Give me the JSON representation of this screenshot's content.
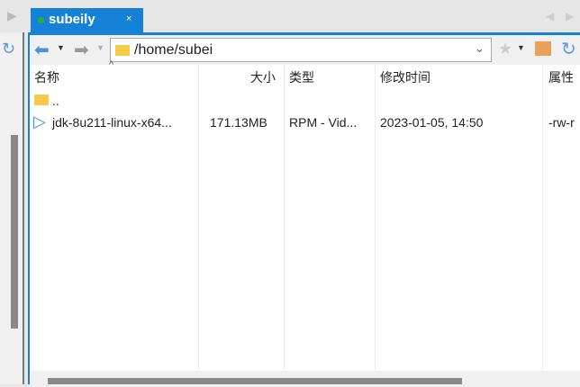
{
  "tab": {
    "title": "subeily",
    "close": "×",
    "status_color": "#27b23a"
  },
  "address": {
    "path": "/home/subei"
  },
  "columns": {
    "name": "名称",
    "size": "大小",
    "type": "类型",
    "modified": "修改时间",
    "attrs": "属性"
  },
  "rows": [
    {
      "name": "..",
      "size": "",
      "type": "",
      "modified": "",
      "attrs": "",
      "icon": "folder-icon"
    },
    {
      "name": "jdk-8u211-linux-x64...",
      "size": "171.13MB",
      "type": "RPM - Vid...",
      "modified": "2023-01-05, 14:50",
      "attrs": "-rw-r",
      "icon": "rpm-file-icon"
    }
  ]
}
